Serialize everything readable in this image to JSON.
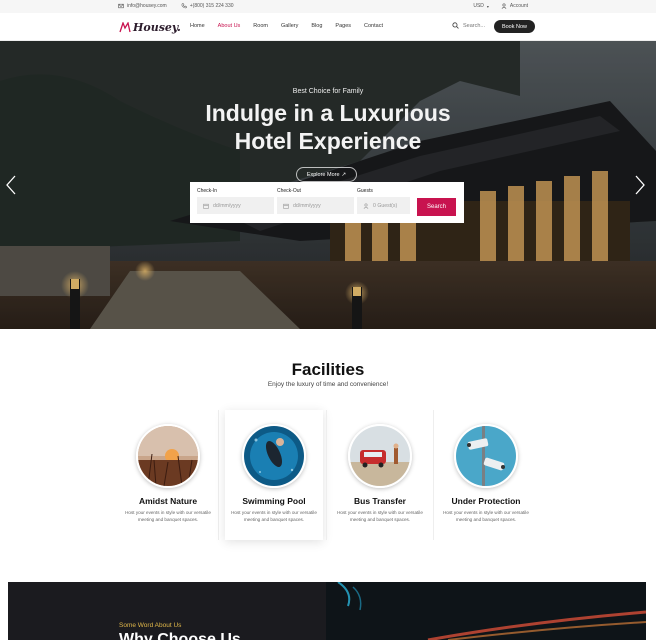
{
  "topbar": {
    "email": "info@housey.com",
    "phone": "+(800) 315 224 330",
    "currency": "USD",
    "account": "Account"
  },
  "nav": {
    "logo": "Housey.",
    "menu": [
      "Home",
      "About Us",
      "Room",
      "Gallery",
      "Blog",
      "Pages",
      "Contact"
    ],
    "active": "About Us",
    "search_placeholder": "Search...",
    "book_now": "Book Now"
  },
  "hero": {
    "subtitle": "Best Choice for Family",
    "title_line1": "Indulge in a Luxurious",
    "title_line2": "Hotel Experience",
    "explore": "Explore More",
    "explore_arrow": "↗"
  },
  "booking": {
    "checkin_label": "Check-In",
    "checkin_placeholder": "dd/mm/yyyy",
    "checkout_label": "Check-Out",
    "checkout_placeholder": "dd/mm/yyyy",
    "guests_label": "Guests",
    "guests_placeholder": "0 Guest(s)",
    "search": "Search"
  },
  "facilities": {
    "title": "Facilities",
    "subtitle": "Enjoy the luxury of time and convenience!",
    "items": [
      {
        "title": "Amidst Nature",
        "desc": "Host your events in style with our versatile meeting and banquet spaces."
      },
      {
        "title": "Swimming Pool",
        "desc": "Host your events in style with our versatile meeting and banquet spaces."
      },
      {
        "title": "Bus Transfer",
        "desc": "Host your events in style with our versatile meeting and banquet spaces."
      },
      {
        "title": "Under Protection",
        "desc": "Host your events in style with our versatile meeting and banquet spaces."
      }
    ]
  },
  "why": {
    "eyebrow": "Some Word About Us",
    "title": "Why Choose Us"
  },
  "colors": {
    "accent": "#c8134f",
    "dark": "#222222",
    "gold": "#e1b84a"
  },
  "icons": [
    "mail-icon",
    "phone-icon",
    "user-icon",
    "search-icon",
    "calendar-icon",
    "chevron-left-icon",
    "chevron-right-icon"
  ]
}
